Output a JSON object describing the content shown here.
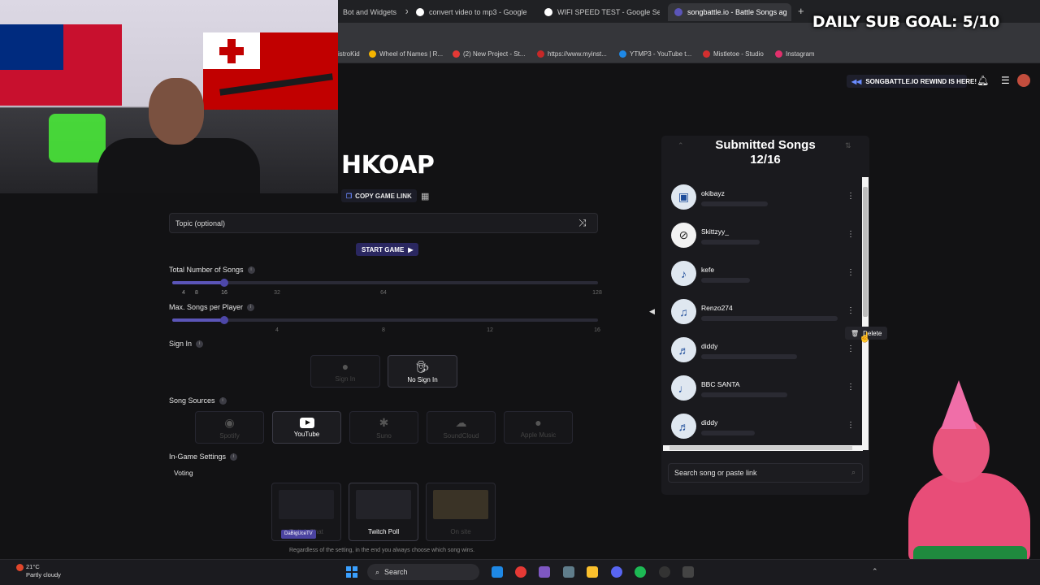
{
  "overlay": {
    "sub_goal": "DAILY SUB GOAL: 5/10"
  },
  "browser": {
    "tabs": [
      {
        "label": "Bot and Widgets",
        "active": false
      },
      {
        "label": "convert video to mp3 - Google",
        "active": false
      },
      {
        "label": "WIFI SPEED TEST - Google Se",
        "active": false
      },
      {
        "label": "songbattle.io - Battle Songs ag",
        "active": true
      }
    ],
    "new_tab_icon": "plus-icon",
    "bookmarks": [
      {
        "label": "istroKid",
        "color": "#e8e8e8"
      },
      {
        "label": "Wheel of Names | R...",
        "color": "#f4b400"
      },
      {
        "label": "(2) New Project - St...",
        "color": "#e53935"
      },
      {
        "label": "https://www.myinst...",
        "color": "#c62828"
      },
      {
        "label": "YTMP3 - YouTube t...",
        "color": "#1e88e5"
      },
      {
        "label": "Mistletoe - Studio",
        "color": "#d32f2f"
      },
      {
        "label": "Instagram",
        "color": "#e1306c"
      }
    ]
  },
  "header": {
    "rewind_label": "SONGBATTLE.IO REWIND IS HERE!",
    "bell_icon": "bell-icon",
    "menu_icon": "hamburger-icon"
  },
  "game": {
    "code": "HKOAP",
    "copy_link_label": "COPY GAME LINK",
    "topic_placeholder": "Topic (optional)",
    "start_label": "START GAME",
    "total_songs": {
      "label": "Total Number of Songs",
      "value": 16,
      "ticks": [
        "4",
        "8",
        "16",
        "32",
        "64",
        "128"
      ]
    },
    "max_per_player": {
      "label": "Max. Songs per Player",
      "value": 4,
      "ticks": [
        "4",
        "8",
        "12",
        "16"
      ]
    },
    "sign_in": {
      "label": "Sign In",
      "options": [
        {
          "label": "Sign In",
          "selected": false
        },
        {
          "label": "No Sign In",
          "selected": true
        }
      ]
    },
    "song_sources": {
      "label": "Song Sources",
      "options": [
        {
          "label": "Spotify",
          "selected": false
        },
        {
          "label": "YouTube",
          "selected": true
        },
        {
          "label": "Suno",
          "selected": false
        },
        {
          "label": "SoundCloud",
          "selected": false
        },
        {
          "label": "Apple Music",
          "selected": false
        }
      ]
    },
    "in_game": {
      "label": "In-Game Settings",
      "voting_label": "Voting",
      "options": [
        {
          "label": "Twitch Chat",
          "selected": false
        },
        {
          "label": "Twitch Poll",
          "selected": true
        },
        {
          "label": "On site",
          "selected": false
        }
      ],
      "streamer_badge": "DaBigUceTV",
      "footnote": "Regardless of the setting, in the end you always choose which song wins."
    }
  },
  "submitted": {
    "title": "Submitted Songs",
    "count": "12/16",
    "songs": [
      {
        "name": "okibayz",
        "icon": "boombox-icon"
      },
      {
        "name": "Skittzyy_",
        "icon": "logo-icon"
      },
      {
        "name": "kefe",
        "icon": "violin-icon"
      },
      {
        "name": "Renzo274",
        "icon": "crowd-icon"
      },
      {
        "name": "diddy",
        "icon": "headphones-icon"
      },
      {
        "name": "BBC SANTA",
        "icon": "guitar-icon"
      },
      {
        "name": "diddy",
        "icon": "headphones-icon"
      }
    ],
    "delete_label": "Delete",
    "search_placeholder": "Search song or paste link"
  },
  "taskbar": {
    "weather_temp": "21°C",
    "weather_desc": "Partly cloudy",
    "search_label": "Search"
  }
}
